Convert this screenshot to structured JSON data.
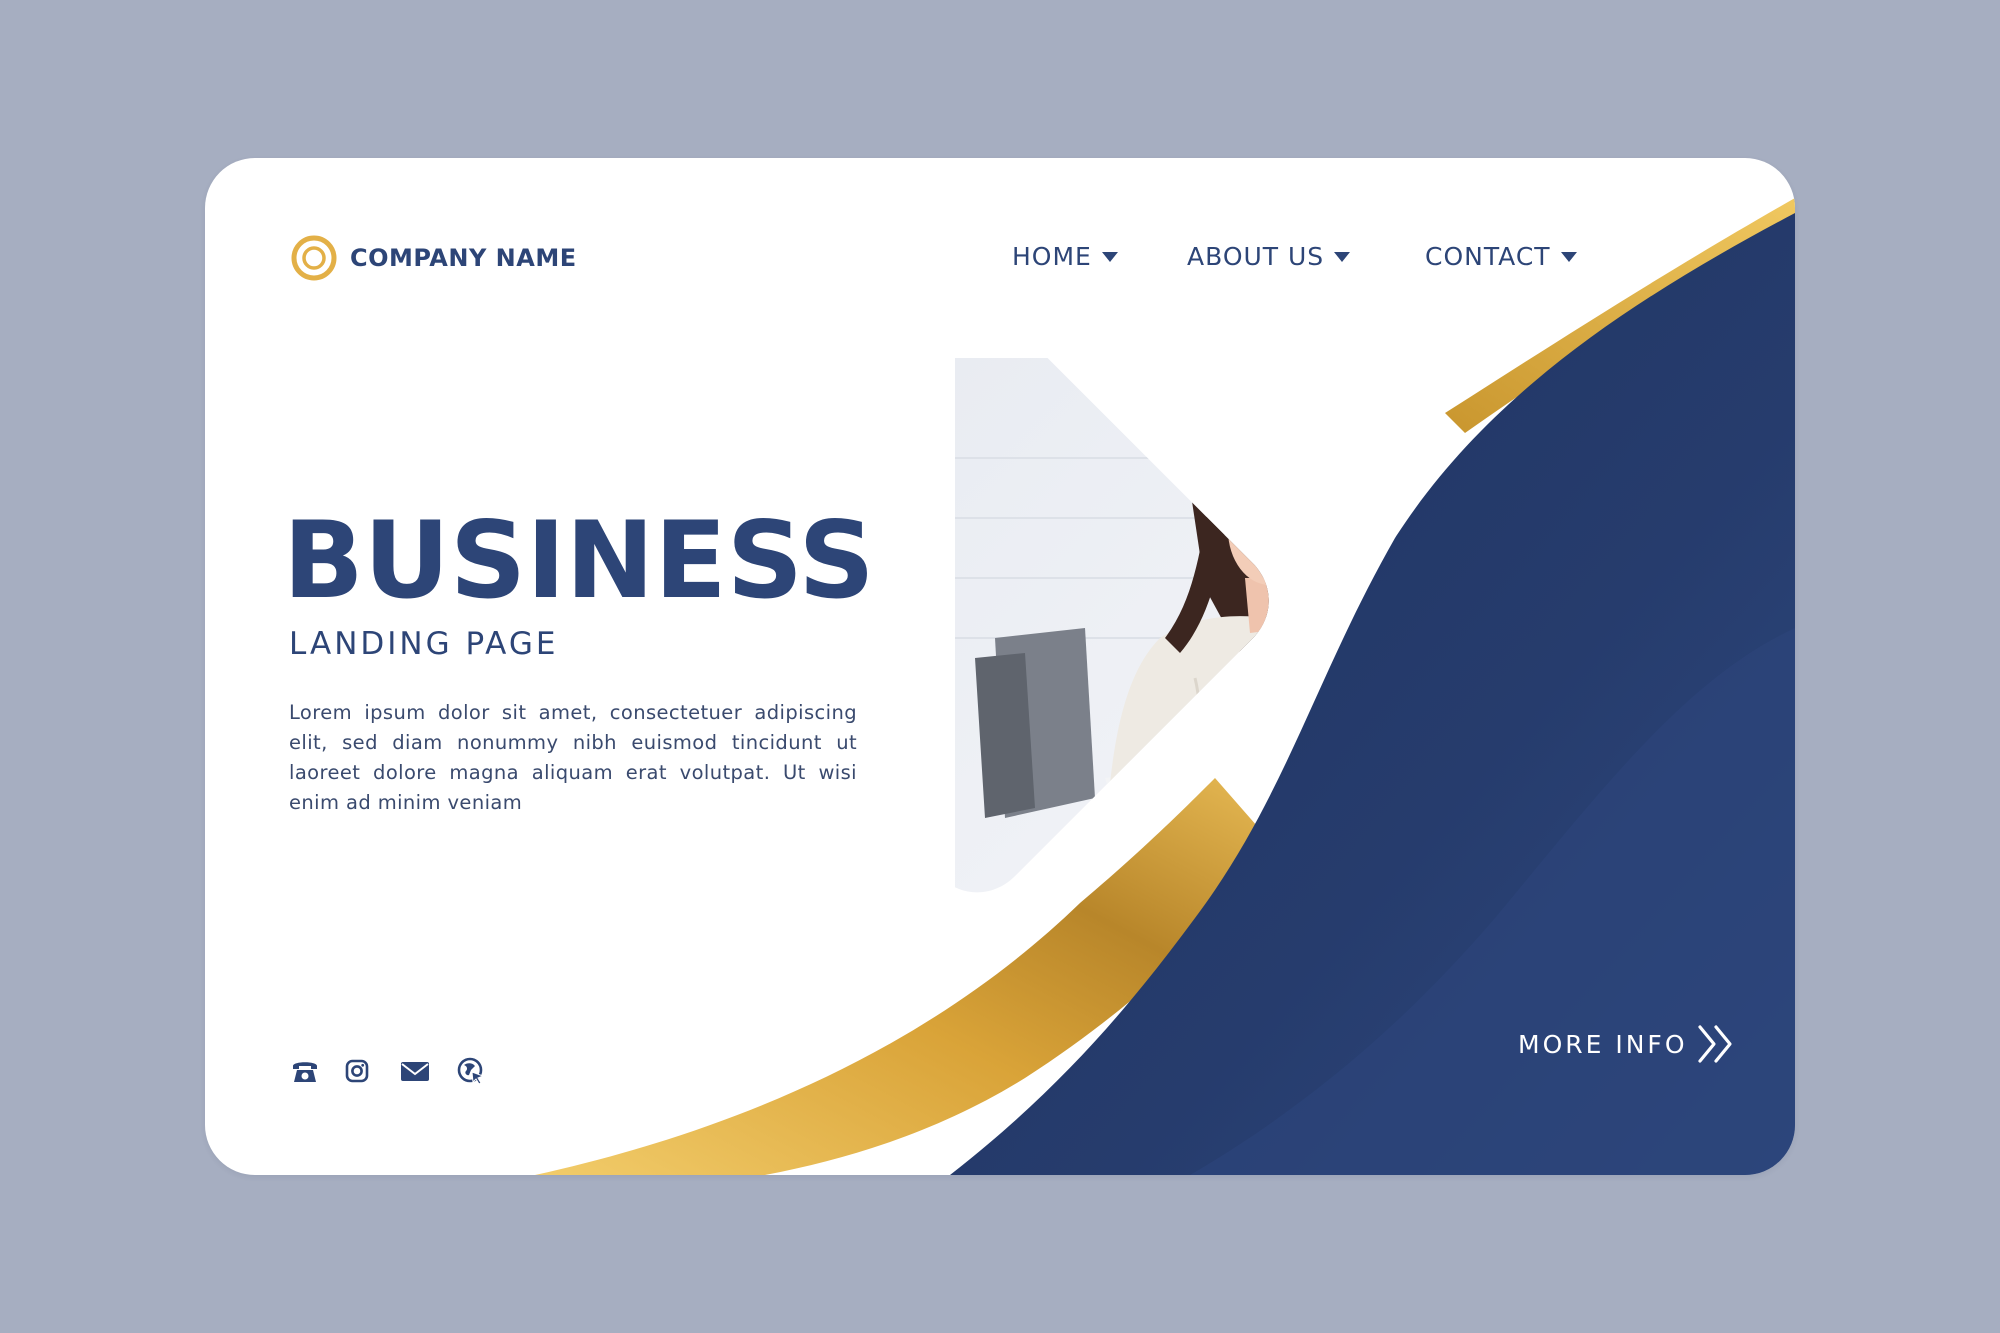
{
  "brand": {
    "company_name": "COMPANY NAME",
    "logo_icon": "concentric-circle-logo"
  },
  "nav": {
    "items": [
      {
        "label": "HOME",
        "icon": "caret-down-icon"
      },
      {
        "label": "ABOUT US",
        "icon": "caret-down-icon"
      },
      {
        "label": "CONTACT",
        "icon": "caret-down-icon"
      }
    ]
  },
  "hero": {
    "title": "BUSINESS",
    "subtitle": "LANDING PAGE",
    "body": "Lorem ipsum dolor sit amet, consectetuer adipiscing elit, sed diam nonummy nibh euismod tincidunt ut laoreet dolore magna aliquam erat volutpat. Ut wisi enim ad minim veniam"
  },
  "social": {
    "icons": [
      "phone-icon",
      "instagram-icon",
      "mail-icon",
      "globe-icon"
    ]
  },
  "cta": {
    "label": "MORE INFO",
    "icon": "double-chevron-right-icon"
  },
  "colors": {
    "page_background": "#a6aec1",
    "card_background": "#ffffff",
    "navy": "#2d4577",
    "navy_dark": "#1f3260",
    "gold": "#e8b84b",
    "gold_dark": "#b8862a"
  }
}
